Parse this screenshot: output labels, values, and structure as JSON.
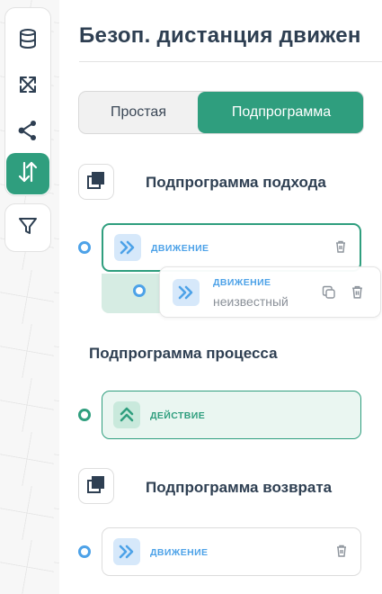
{
  "title": "Безоп. дистанция движен",
  "toolbar": {
    "items": [
      {
        "icon": "database-icon"
      },
      {
        "icon": "expand-arrows-icon"
      },
      {
        "icon": "share-nodes-icon"
      },
      {
        "icon": "swap-vertical-icon",
        "active": true
      }
    ],
    "filter_icon": "filter-icon"
  },
  "tabs": {
    "simple": "Простая",
    "subprogram": "Подпрограмма",
    "selected": "subprogram"
  },
  "sections": {
    "approach": {
      "label": "Подпрограмма подхода",
      "step": {
        "type": "ДВИЖЕНИЕ",
        "icon": "chevrons-right-icon"
      }
    },
    "process": {
      "label": "Подпрограмма процесса",
      "step": {
        "type": "ДЕЙСТВИЕ",
        "icon": "chevrons-up-icon"
      }
    },
    "return": {
      "label": "Подпрограмма возврата",
      "step": {
        "type": "ДВИЖЕНИЕ",
        "icon": "chevrons-right-icon"
      }
    }
  },
  "drag_item": {
    "type": "ДВИЖЕНИЕ",
    "subtitle": "неизвестный",
    "icon": "chevrons-right-icon"
  },
  "colors": {
    "accent_green": "#2f9e7e",
    "accent_blue": "#4da2e8",
    "text_dark": "#2e3f52"
  }
}
